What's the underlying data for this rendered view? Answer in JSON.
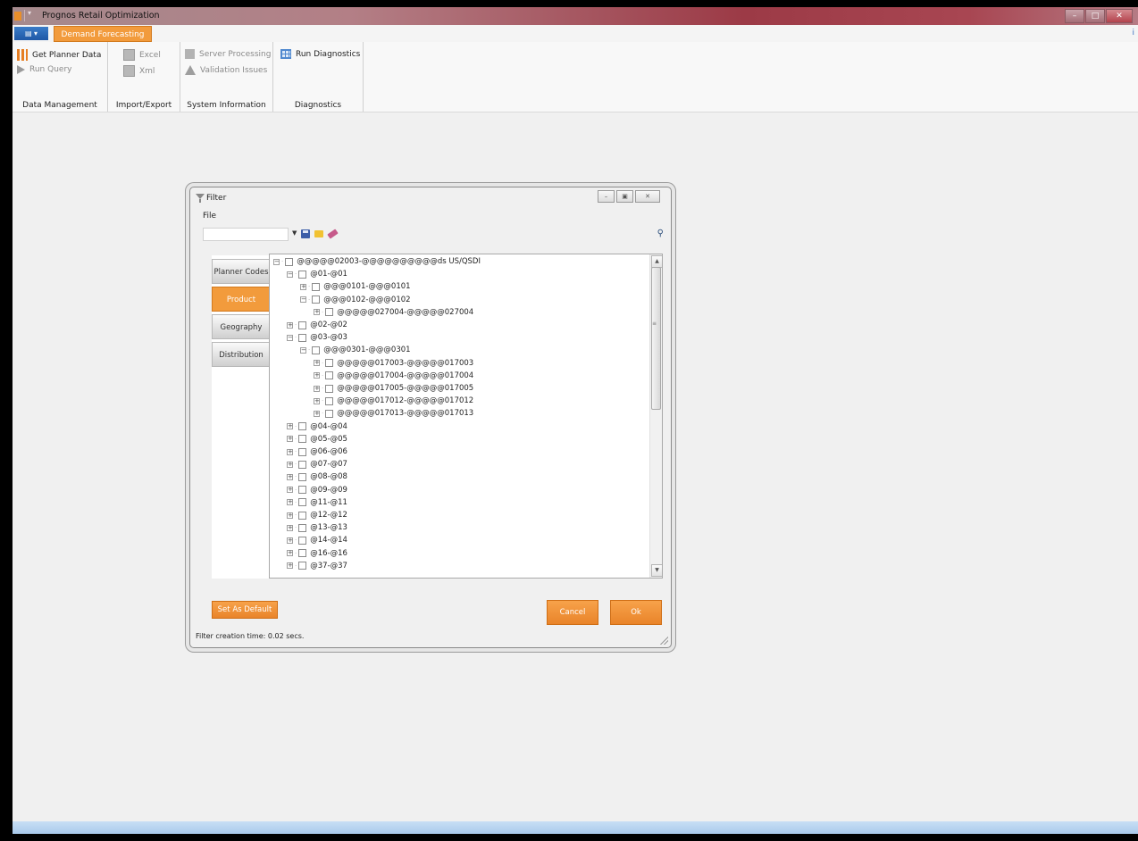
{
  "window": {
    "title": "Prognos Retail Optimization",
    "controls": [
      "minimize",
      "maximize",
      "close"
    ]
  },
  "ribbon": {
    "active_tab": "Demand Forecasting",
    "groups": [
      {
        "label": "Data Management",
        "buttons": [
          "Get Planner Data",
          "Run Query"
        ]
      },
      {
        "label": "Import/Export",
        "buttons": [
          "Excel",
          "Xml"
        ]
      },
      {
        "label": "System Information",
        "buttons": [
          "Server Processing",
          "Validation Issues"
        ]
      },
      {
        "label": "Diagnostics",
        "buttons": [
          "Run Diagnostics"
        ]
      }
    ]
  },
  "dialog": {
    "title": "Filter",
    "menu": "File",
    "side_tabs": [
      "Planner Codes",
      "Product",
      "Geography",
      "Distribution"
    ],
    "active_side_tab": "Product",
    "tree": [
      {
        "label": "@@@@@02003-@@@@@@@@@@ds US/QSDI",
        "level": 0,
        "expanded": true
      },
      {
        "label": "@01-@01",
        "level": 1,
        "expanded": true
      },
      {
        "label": "@@@0101-@@@0101",
        "level": 2,
        "expanded": false
      },
      {
        "label": "@@@0102-@@@0102",
        "level": 2,
        "expanded": true
      },
      {
        "label": "@@@@@027004-@@@@@027004",
        "level": 3,
        "expanded": false
      },
      {
        "label": "@02-@02",
        "level": 1,
        "expanded": false
      },
      {
        "label": "@03-@03",
        "level": 1,
        "expanded": true
      },
      {
        "label": "@@@0301-@@@0301",
        "level": 2,
        "expanded": true
      },
      {
        "label": "@@@@@017003-@@@@@017003",
        "level": 3,
        "expanded": false
      },
      {
        "label": "@@@@@017004-@@@@@017004",
        "level": 3,
        "expanded": false
      },
      {
        "label": "@@@@@017005-@@@@@017005",
        "level": 3,
        "expanded": false
      },
      {
        "label": "@@@@@017012-@@@@@017012",
        "level": 3,
        "expanded": false
      },
      {
        "label": "@@@@@017013-@@@@@017013",
        "level": 3,
        "expanded": false
      },
      {
        "label": "@04-@04",
        "level": 1,
        "expanded": false
      },
      {
        "label": "@05-@05",
        "level": 1,
        "expanded": false
      },
      {
        "label": "@06-@06",
        "level": 1,
        "expanded": false
      },
      {
        "label": "@07-@07",
        "level": 1,
        "expanded": false
      },
      {
        "label": "@08-@08",
        "level": 1,
        "expanded": false
      },
      {
        "label": "@09-@09",
        "level": 1,
        "expanded": false
      },
      {
        "label": "@11-@11",
        "level": 1,
        "expanded": false
      },
      {
        "label": "@12-@12",
        "level": 1,
        "expanded": false
      },
      {
        "label": "@13-@13",
        "level": 1,
        "expanded": false
      },
      {
        "label": "@14-@14",
        "level": 1,
        "expanded": false
      },
      {
        "label": "@16-@16",
        "level": 1,
        "expanded": false
      },
      {
        "label": "@37-@37",
        "level": 1,
        "expanded": false
      }
    ],
    "buttons": {
      "set_default": "Set As Default",
      "cancel": "Cancel",
      "ok": "Ok"
    },
    "status": "Filter creation time: 0.02 secs."
  },
  "colors": {
    "accent": "#f29b3c",
    "title_bar": "#9c3a46",
    "app_menu": "#2a6bbd"
  }
}
